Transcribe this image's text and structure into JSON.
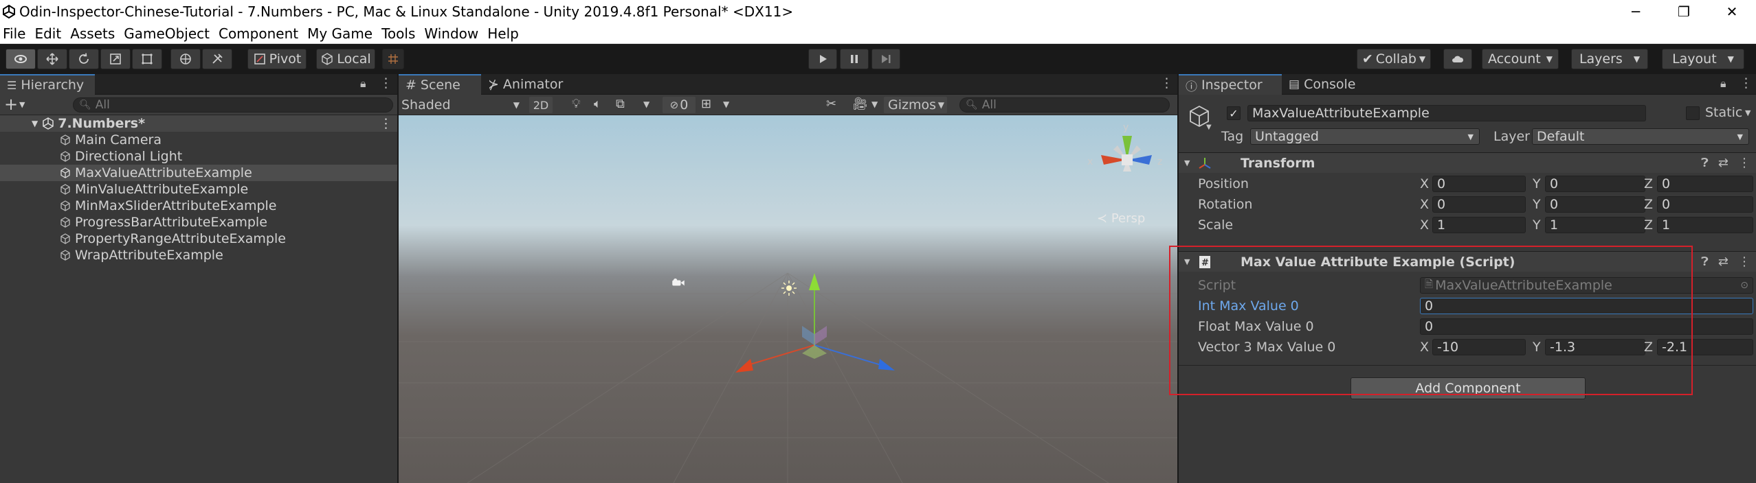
{
  "window": {
    "title": "Odin-Inspector-Chinese-Tutorial - 7.Numbers - PC, Mac & Linux Standalone - Unity 2019.4.8f1 Personal* <DX11>",
    "minimize": "─",
    "maximize": "❐",
    "close": "✕"
  },
  "menu": [
    "File",
    "Edit",
    "Assets",
    "GameObject",
    "Component",
    "My Game",
    "Tools",
    "Window",
    "Help"
  ],
  "toolbar": {
    "pivot_label": "Pivot",
    "local_label": "Local",
    "collab_label": "Collab",
    "account_label": "Account",
    "layers_label": "Layers",
    "layout_label": "Layout"
  },
  "hierarchy": {
    "tab_label": "Hierarchy",
    "search_placeholder": "All",
    "scene_name": "7.Numbers*",
    "items": [
      {
        "label": "Main Camera"
      },
      {
        "label": "Directional Light"
      },
      {
        "label": "MaxValueAttributeExample",
        "selected": true
      },
      {
        "label": "MinValueAttributeExample"
      },
      {
        "label": "MinMaxSliderAttributeExample"
      },
      {
        "label": "ProgressBarAttributeExample"
      },
      {
        "label": "PropertyRangeAttributeExample"
      },
      {
        "label": "WrapAttributeExample"
      }
    ]
  },
  "scene": {
    "tab_scene": "Scene",
    "tab_animator": "Animator",
    "shading_mode": "Shaded",
    "mode_2d": "2D",
    "hidden_count": "0",
    "gizmos_label": "Gizmos",
    "search_placeholder": "All",
    "persp_label": "Persp",
    "gizmo_x": "x",
    "gizmo_y": "y",
    "gizmo_z": "z"
  },
  "inspector": {
    "tab_label": "Inspector",
    "console_label": "Console",
    "object_name": "MaxValueAttributeExample",
    "static_label": "Static",
    "tag_label": "Tag",
    "tag_value": "Untagged",
    "layer_label": "Layer",
    "layer_value": "Default",
    "transform": {
      "title": "Transform",
      "position": {
        "label": "Position",
        "x": "0",
        "y": "0",
        "z": "0"
      },
      "rotation": {
        "label": "Rotation",
        "x": "0",
        "y": "0",
        "z": "0"
      },
      "scale": {
        "label": "Scale",
        "x": "1",
        "y": "1",
        "z": "1"
      }
    },
    "script_component": {
      "title": "Max Value Attribute Example (Script)",
      "script_label": "Script",
      "script_value": "MaxValueAttributeExample",
      "int_label": "Int Max Value 0",
      "int_value": "0",
      "float_label": "Float Max Value 0",
      "float_value": "0",
      "vector_label": "Vector 3 Max Value 0",
      "vector_x": "-10",
      "vector_y": "-1.3",
      "vector_z": "-2.1"
    },
    "add_component_label": "Add Component",
    "axis_x": "X",
    "axis_y": "Y",
    "axis_z": "Z"
  },
  "colors": {
    "accent": "#3a79bb",
    "highlight_box": "#d5202a",
    "panel_bg": "#383838"
  }
}
